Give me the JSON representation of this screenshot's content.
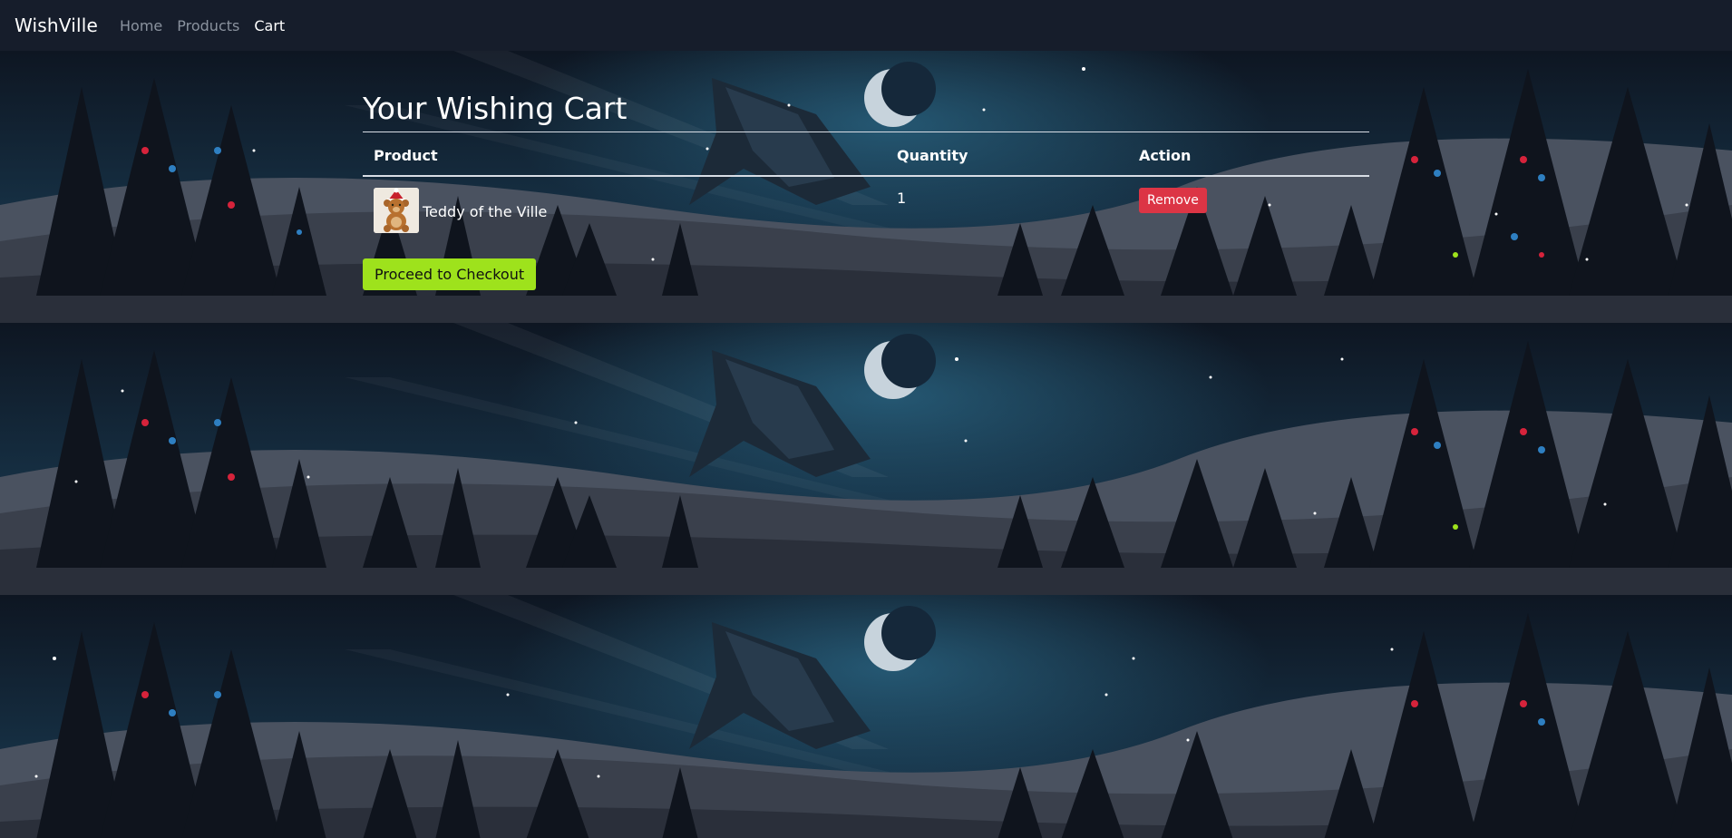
{
  "navbar": {
    "brand": "WishVille",
    "links": [
      {
        "label": "Home",
        "active": false
      },
      {
        "label": "Products",
        "active": false
      },
      {
        "label": "Cart",
        "active": true
      }
    ]
  },
  "main": {
    "title": "Your Wishing Cart",
    "columns": [
      "Product",
      "Quantity",
      "Action"
    ],
    "items": [
      {
        "name": "Teddy of the Ville",
        "quantity": "1",
        "action_label": "Remove",
        "thumbnail_icon": "teddy-bear-image"
      }
    ],
    "checkout_label": "Proceed to Checkout"
  },
  "colors": {
    "navbar_bg": "#161d2b",
    "page_bg": "#0d121b",
    "remove_button": "#dc3545",
    "checkout_button": "#9ee21c",
    "nav_link_inactive": "#8a929e"
  }
}
